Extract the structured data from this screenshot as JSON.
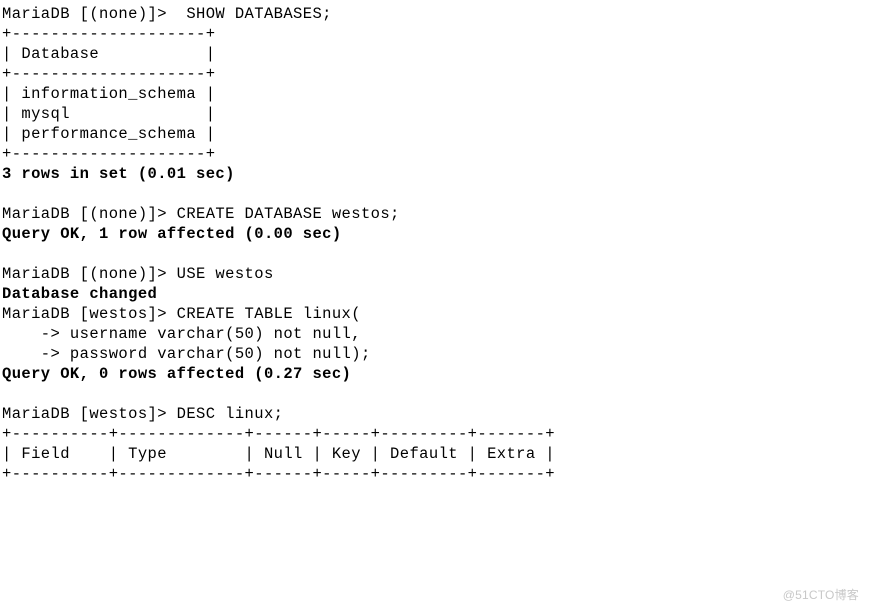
{
  "terminal": {
    "l1": "MariaDB [(none)]>  SHOW DATABASES;",
    "l2": "+--------------------+",
    "l3": "| Database           |",
    "l4": "+--------------------+",
    "l5": "| information_schema |",
    "l6": "| mysql              |",
    "l7": "| performance_schema |",
    "l8": "+--------------------+",
    "l9": "3 rows in set (0.01 sec)",
    "l10": "",
    "l11": "MariaDB [(none)]> CREATE DATABASE westos;",
    "l12": "Query OK, 1 row affected (0.00 sec)",
    "l13": "",
    "l14": "MariaDB [(none)]> USE westos",
    "l15": "Database changed",
    "l16": "MariaDB [westos]> CREATE TABLE linux(",
    "l17": "    -> username varchar(50) not null,",
    "l18": "    -> password varchar(50) not null);",
    "l19": "Query OK, 0 rows affected (0.27 sec)",
    "l20": "",
    "l21": "MariaDB [westos]> DESC linux;",
    "l22": "+----------+-------------+------+-----+---------+-------+",
    "l23": "| Field    | Type        | Null | Key | Default | Extra |",
    "l24": "+----------+-------------+------+-----+---------+-------+"
  },
  "watermark": "@51CTO博客"
}
